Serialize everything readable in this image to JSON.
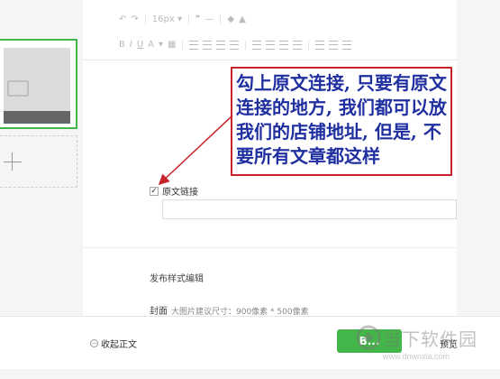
{
  "toolbar": {
    "font_size": "16px",
    "font_size_caret": "▾",
    "quote_glyph": "❞",
    "row2_glyphs": [
      "B",
      "I",
      "U",
      "A",
      "▾"
    ]
  },
  "callout": {
    "text": "勾上原文连接, 只要有原文连接的地方, 我们都可以放我们的店铺地址, 但是, 不要所有文章都这样",
    "color_border": "#c8222a",
    "color_text": "#1f2fa0"
  },
  "original_link": {
    "checked_mark": "✓",
    "label": "原文链接"
  },
  "publish": {
    "section_label": "发布样式编辑",
    "cover_label": "封面",
    "cover_hint": "大图片建议尺寸：900像素 * 500像素"
  },
  "footer": {
    "collapse_label": "收起正文",
    "save_label": "B...",
    "preview_label": "预览"
  },
  "watermark": {
    "brand": "当下软件园",
    "url": "www.downxia.com"
  },
  "colors": {
    "accent_green": "#44b549"
  }
}
